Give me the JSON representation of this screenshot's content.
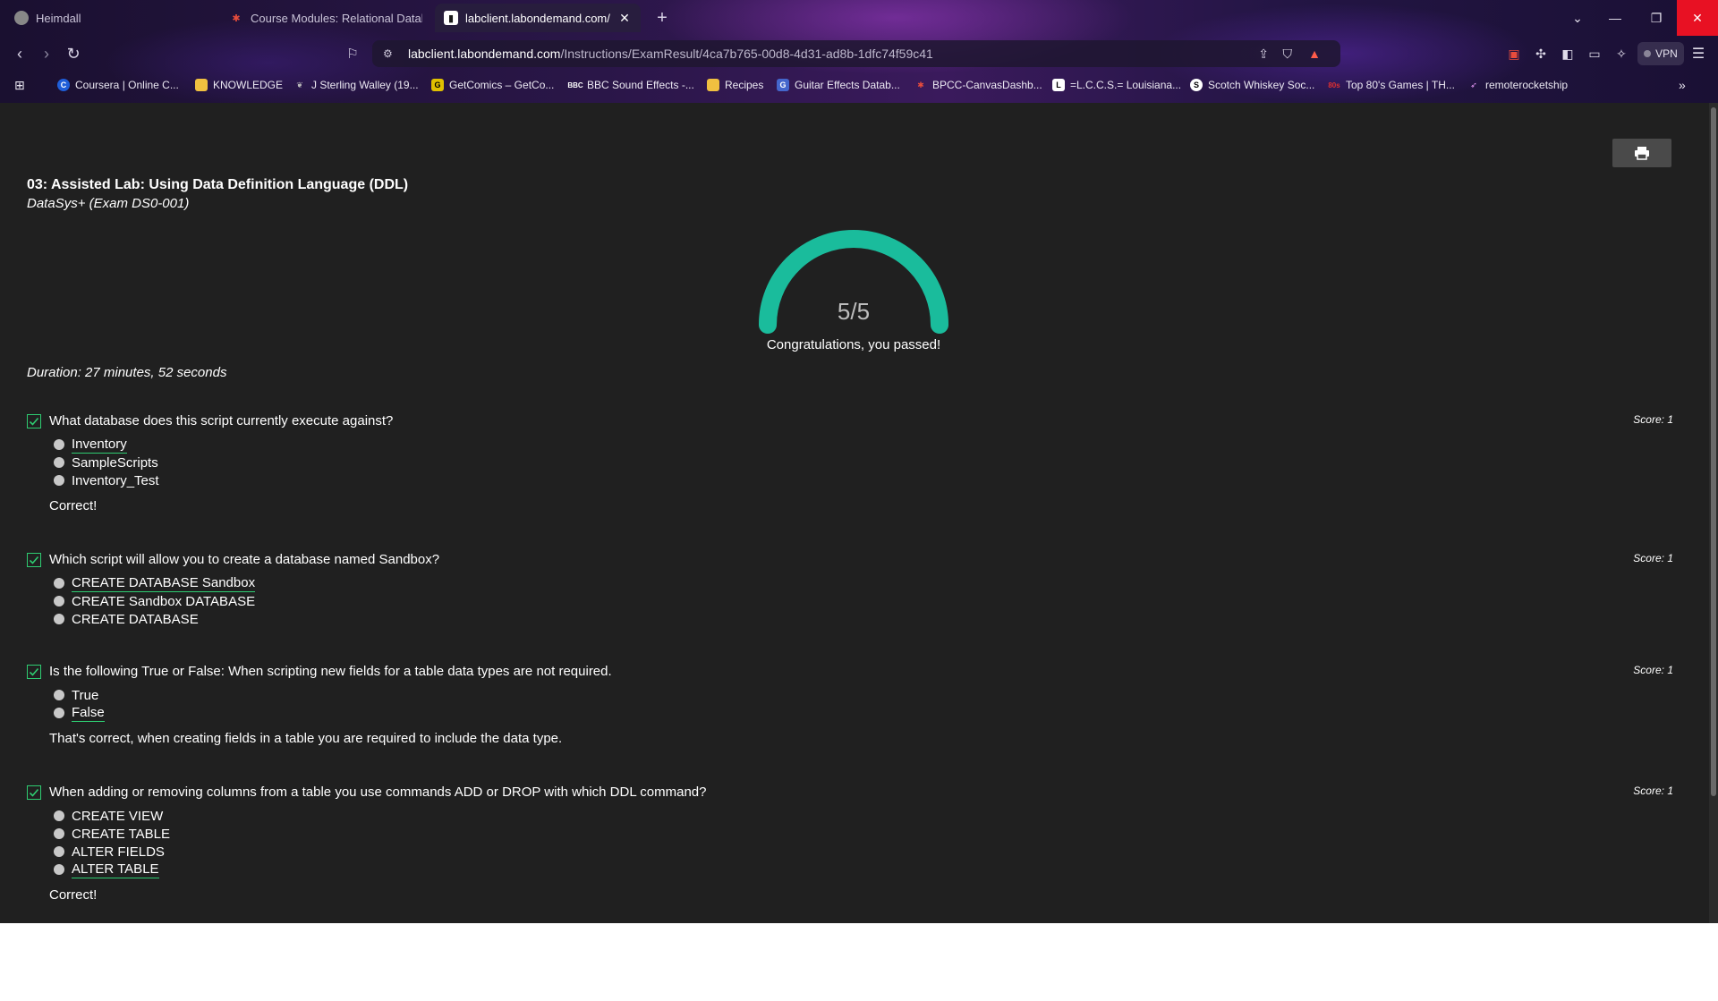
{
  "browser": {
    "tabs": [
      {
        "title": "Heimdall",
        "active": false
      },
      {
        "title": "Course Modules: Relational Databa",
        "active": false
      },
      {
        "title": "labclient.labondemand.com/Ins",
        "active": true
      }
    ],
    "new_tab": "+",
    "url_host": "labclient.labondemand.com",
    "url_path": "/Instructions/ExamResult/4ca7b765-00d8-4d31-ad8b-1dfc74f59c41",
    "vpn_label": "VPN",
    "bookmarks": [
      {
        "label": "Coursera | Online C...",
        "icon": "C"
      },
      {
        "label": "KNOWLEDGE",
        "icon": "folder"
      },
      {
        "label": "J Sterling Walley (19...",
        "icon": "leaf"
      },
      {
        "label": "GetComics – GetCo...",
        "icon": "gc"
      },
      {
        "label": "BBC Sound Effects -...",
        "icon": "bbc"
      },
      {
        "label": "Recipes",
        "icon": "folder"
      },
      {
        "label": "Guitar Effects Datab...",
        "icon": "g"
      },
      {
        "label": "BPCC-CanvasDashb...",
        "icon": "b"
      },
      {
        "label": "=L.C.C.S.= Louisiana...",
        "icon": "l"
      },
      {
        "label": "Scotch Whiskey Soc...",
        "icon": "s"
      },
      {
        "label": "Top 80's Games | TH...",
        "icon": "t"
      },
      {
        "label": "remoterocketship",
        "icon": "rocket"
      }
    ]
  },
  "exam": {
    "title": "03: Assisted Lab: Using Data Definition Language (DDL)",
    "subtitle": "DataSys+ (Exam DS0-001)",
    "score_display": "5/5",
    "score_fraction": 1.0,
    "result_message": "Congratulations, you passed!",
    "duration": "Duration: 27 minutes, 52 seconds",
    "accent_color": "#1abc9c",
    "questions": [
      {
        "text": "What database does this script currently execute against?",
        "score": "Score: 1",
        "options": [
          "Inventory",
          "SampleScripts",
          "Inventory_Test"
        ],
        "selected": 0,
        "feedback": "Correct!"
      },
      {
        "text": "Which script will allow you to create a database named Sandbox?",
        "score": "Score: 1",
        "options": [
          "CREATE DATABASE Sandbox",
          "CREATE Sandbox DATABASE",
          "CREATE DATABASE"
        ],
        "selected": 0,
        "feedback": ""
      },
      {
        "text": "Is the following True or False: When scripting new fields for a table data types are not required.",
        "score": "Score: 1",
        "options": [
          "True",
          "False"
        ],
        "selected": 1,
        "feedback": "That's correct, when creating fields in a table you are required to include the data type."
      },
      {
        "text": "When adding or removing columns from a table you use commands ADD or DROP with which DDL command?",
        "score": "Score: 1",
        "options": [
          "CREATE VIEW",
          "CREATE TABLE",
          "ALTER FIELDS",
          "ALTER TABLE"
        ],
        "selected": 3,
        "feedback": "Correct!"
      }
    ]
  }
}
